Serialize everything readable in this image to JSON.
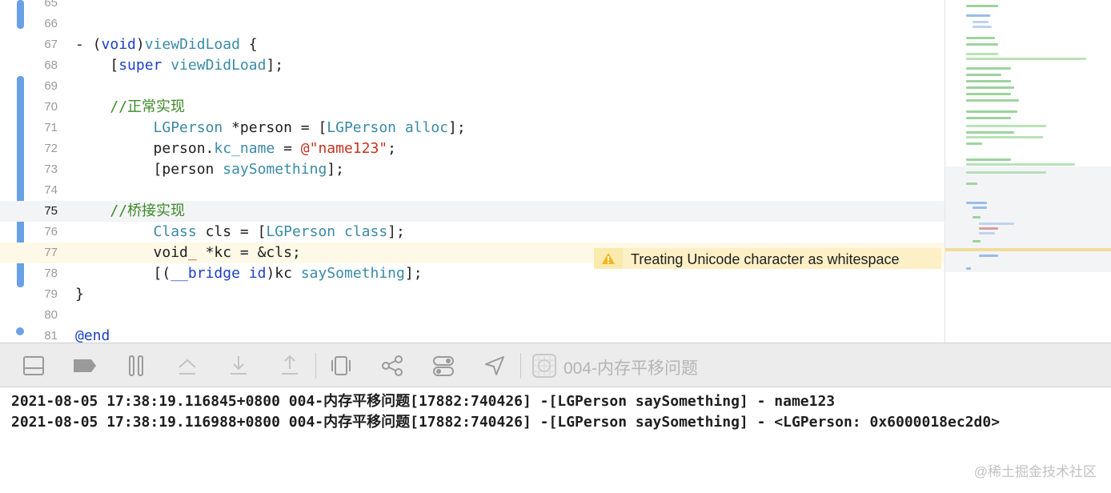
{
  "editor": {
    "lines": [
      {
        "num": "65",
        "tokens": []
      },
      {
        "num": "66",
        "tokens": []
      },
      {
        "num": "67",
        "tokens": [
          {
            "t": "- ("
          },
          {
            "t": "void",
            "c": "kw"
          },
          {
            "t": ")"
          },
          {
            "t": "viewDidLoad",
            "c": "ty"
          },
          {
            "t": " {"
          }
        ]
      },
      {
        "num": "68",
        "tokens": [
          {
            "t": "    ["
          },
          {
            "t": "super",
            "c": "kw"
          },
          {
            "t": " "
          },
          {
            "t": "viewDidLoad",
            "c": "ty"
          },
          {
            "t": "];"
          }
        ]
      },
      {
        "num": "69",
        "tokens": []
      },
      {
        "num": "70",
        "tokens": [
          {
            "t": "    "
          },
          {
            "t": "//正常实现",
            "c": "cm"
          }
        ]
      },
      {
        "num": "71",
        "tokens": [
          {
            "t": "         "
          },
          {
            "t": "LGPerson",
            "c": "ty"
          },
          {
            "t": " *person = ["
          },
          {
            "t": "LGPerson",
            "c": "ty"
          },
          {
            "t": " "
          },
          {
            "t": "alloc",
            "c": "ty"
          },
          {
            "t": "];"
          }
        ]
      },
      {
        "num": "72",
        "tokens": [
          {
            "t": "         person."
          },
          {
            "t": "kc_name",
            "c": "prop"
          },
          {
            "t": " = "
          },
          {
            "t": "@\"name123\"",
            "c": "str"
          },
          {
            "t": ";"
          }
        ]
      },
      {
        "num": "73",
        "tokens": [
          {
            "t": "         [person "
          },
          {
            "t": "saySomething",
            "c": "ty"
          },
          {
            "t": "];"
          }
        ]
      },
      {
        "num": "74",
        "tokens": []
      },
      {
        "num": "75",
        "tokens": [
          {
            "t": "    "
          },
          {
            "t": "//桥接实现",
            "c": "cm"
          }
        ]
      },
      {
        "num": "76",
        "tokens": [
          {
            "t": "         "
          },
          {
            "t": "Class",
            "c": "ty"
          },
          {
            "t": " cls = ["
          },
          {
            "t": "LGPerson",
            "c": "ty"
          },
          {
            "t": " "
          },
          {
            "t": "class",
            "c": "ty"
          },
          {
            "t": "];"
          }
        ]
      },
      {
        "num": "77",
        "tokens": [
          {
            "t": "         void"
          },
          {
            "t": "_",
            "c": "str"
          },
          {
            "t": " *kc = &cls;"
          }
        ]
      },
      {
        "num": "78",
        "tokens": [
          {
            "t": "         [("
          },
          {
            "t": "__bridge",
            "c": "kw"
          },
          {
            "t": " "
          },
          {
            "t": "id",
            "c": "kw"
          },
          {
            "t": ")kc "
          },
          {
            "t": "saySomething",
            "c": "ty"
          },
          {
            "t": "];"
          }
        ]
      },
      {
        "num": "79",
        "tokens": [
          {
            "t": "}"
          }
        ]
      },
      {
        "num": "80",
        "tokens": []
      },
      {
        "num": "81",
        "tokens": [
          {
            "t": "@end",
            "c": "kw"
          }
        ]
      }
    ],
    "current_line": "75",
    "warning_line": "77",
    "warning_text": "Treating Unicode character as whitespace"
  },
  "toolbar": {
    "target_label": "004-内存平移问题",
    "icons": [
      "hide-debug-area-icon",
      "breakpoints-toggle-icon",
      "pause-icon",
      "step-over-icon",
      "step-into-icon",
      "step-out-icon",
      "view-hierarchy-icon",
      "memory-graph-icon",
      "environment-overrides-icon",
      "simulate-location-icon",
      "target-app-icon"
    ]
  },
  "console": {
    "lines": [
      "2021-08-05 17:38:19.116845+0800 004-内存平移问题[17882:740426] -[LGPerson saySomething] - name123",
      "2021-08-05 17:38:19.116988+0800 004-内存平移问题[17882:740426] -[LGPerson saySomething] - <LGPerson: 0x6000018ec2d0>"
    ]
  },
  "watermark": "@稀土掘金技术社区"
}
